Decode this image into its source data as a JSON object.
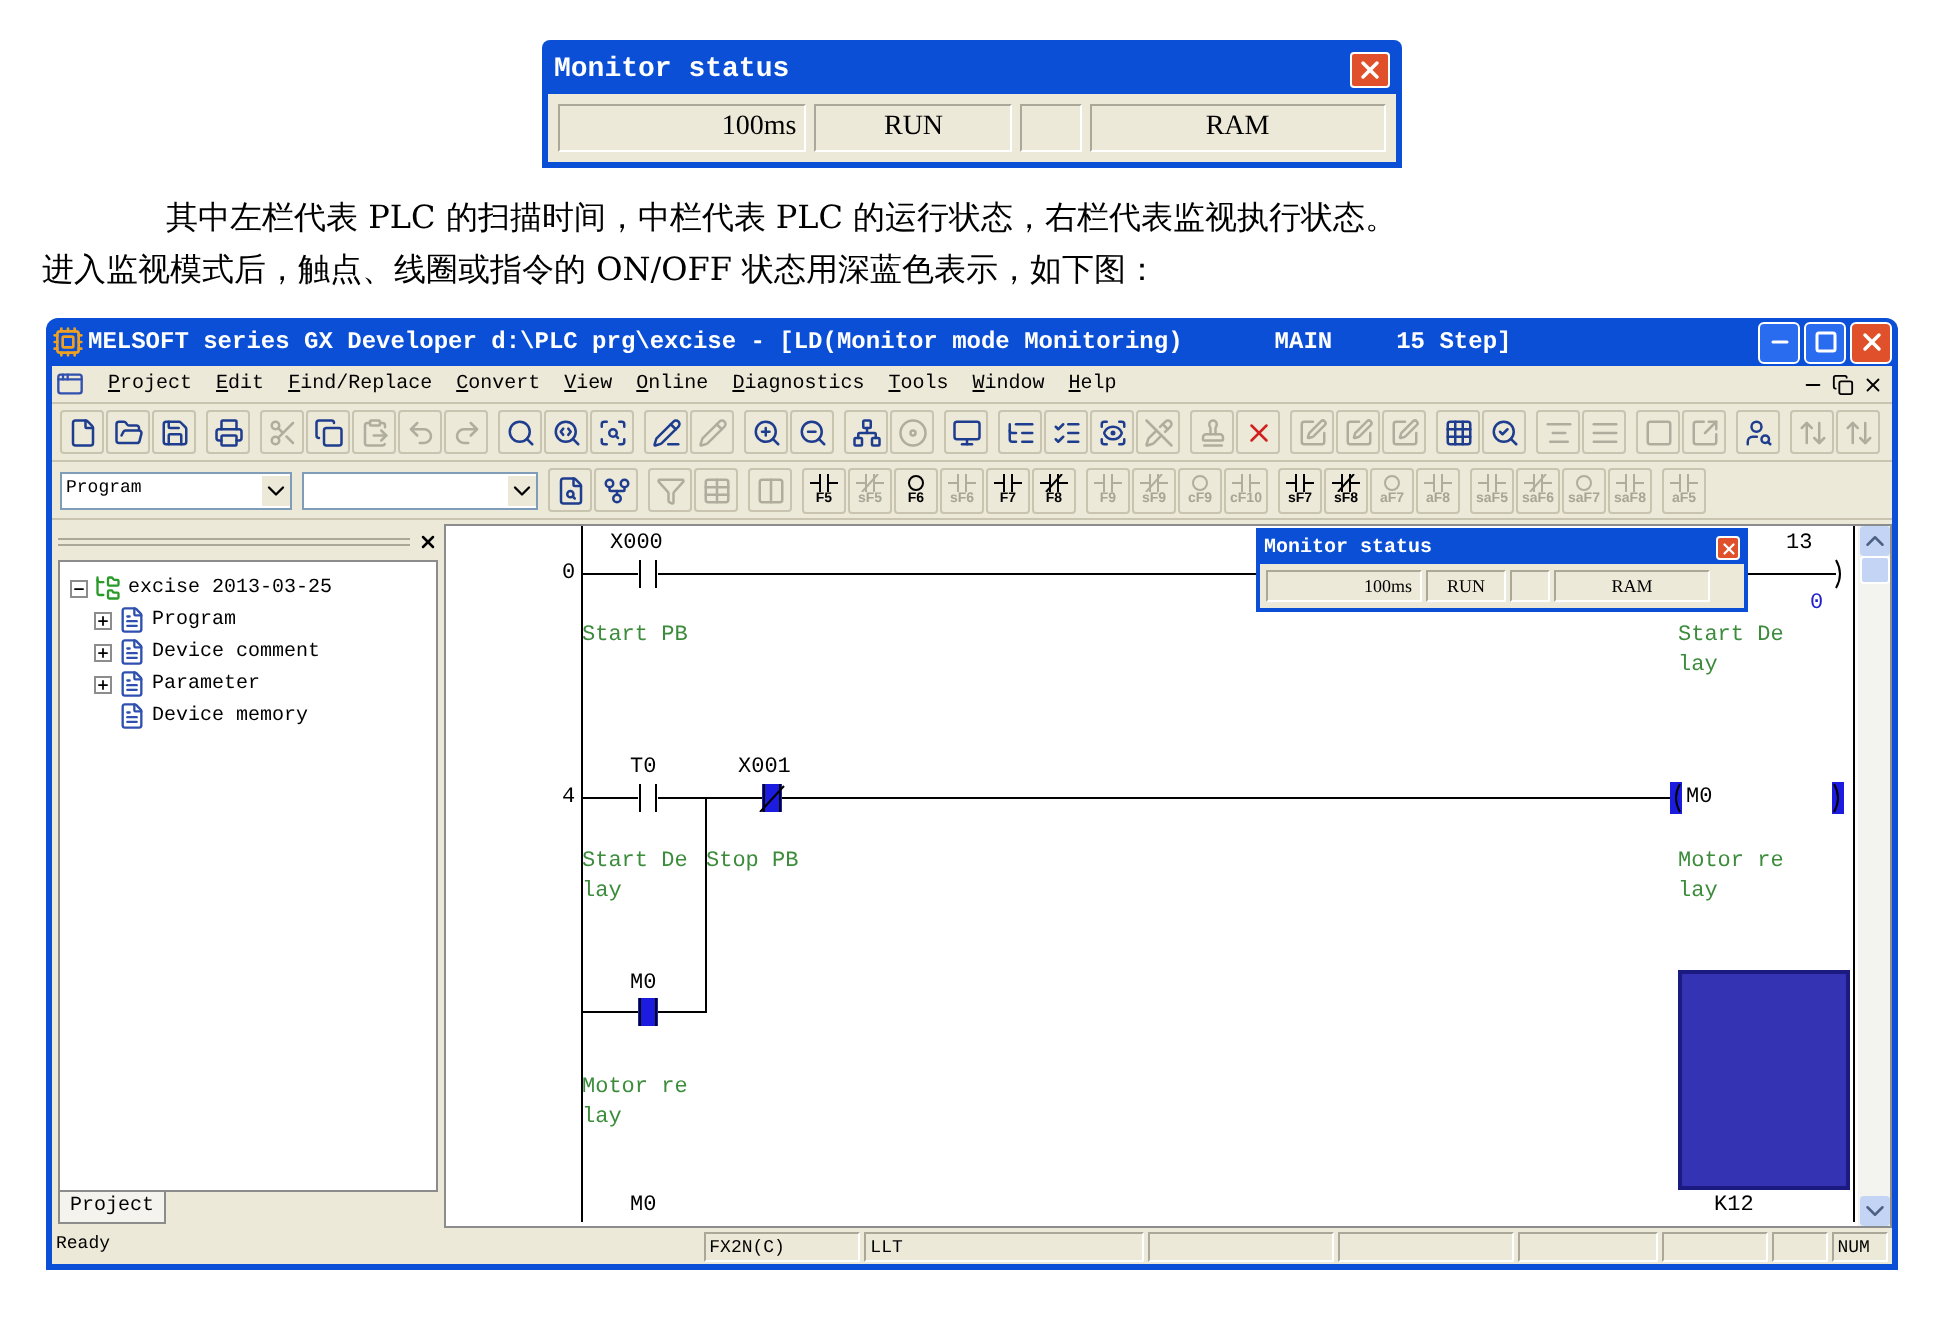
{
  "monitor_dialog": {
    "title": "Monitor status",
    "cells": [
      {
        "text": "100ms"
      },
      {
        "text": "RUN"
      },
      {},
      {
        "text": "RAM"
      }
    ]
  },
  "paragraph_lines": [
    "其中左栏代表 PLC 的扫描时间，中栏代表 PLC 的运行状态，右栏代表监视执行状态。",
    "进入监视模式后，触点、线圈或指令的 ON/OFF 状态用深蓝色表示，如下图："
  ],
  "window": {
    "title_parts": [
      "MELSOFT series GX Developer d:\\PLC prg\\excise - [LD(Monitor mode Monitoring)",
      "MAIN",
      "15 Step]"
    ],
    "menu": [
      "Project",
      "Edit",
      "Find/Replace",
      "Convert",
      "View",
      "Online",
      "Diagnostics",
      "Tools",
      "Window",
      "Help"
    ],
    "toolbar_1": [
      [
        {
          "disabled": false
        },
        {
          "disabled": false
        },
        {
          "disabled": false
        }
      ],
      [
        {
          "disabled": false
        }
      ],
      [
        {
          "disabled": true
        },
        {
          "disabled": false
        },
        {
          "disabled": true
        },
        {
          "disabled": true
        },
        {
          "disabled": true
        }
      ],
      [
        {
          "disabled": false
        },
        {
          "disabled": false
        },
        {
          "disabled": false
        }
      ],
      [
        {
          "disabled": false
        },
        {
          "disabled": true
        }
      ],
      [
        {
          "disabled": false
        },
        {
          "disabled": false
        }
      ],
      [
        {
          "disabled": false
        },
        {
          "disabled": true
        }
      ],
      [
        {
          "disabled": false
        }
      ],
      [
        {
          "disabled": false
        },
        {
          "disabled": false
        },
        {
          "disabled": false
        },
        {
          "disabled": true
        }
      ],
      [
        {
          "disabled": true
        },
        {
          "disabled": false
        }
      ],
      [
        {
          "disabled": true
        },
        {
          "disabled": true
        },
        {
          "disabled": true
        }
      ],
      [
        {
          "disabled": false
        },
        {
          "disabled": false
        }
      ],
      [
        {
          "disabled": true
        },
        {
          "disabled": true
        }
      ],
      [
        {
          "disabled": true
        },
        {
          "disabled": true
        }
      ],
      [
        {
          "disabled": false
        }
      ],
      [
        {
          "disabled": true
        },
        {
          "disabled": true
        }
      ]
    ],
    "toolbar_2": {
      "program_select": {
        "value": "Program"
      },
      "icons": [
        [
          {
            "disabled": false
          },
          {
            "disabled": false
          }
        ],
        [
          {
            "disabled": true
          },
          {
            "disabled": true
          }
        ],
        [
          {
            "disabled": true
          }
        ]
      ],
      "keys": [
        [
          {
            "label": "F5",
            "disabled": false
          },
          {
            "label": "sF5",
            "disabled": true
          },
          {
            "label": "F6",
            "disabled": false
          },
          {
            "label": "sF6",
            "disabled": true
          },
          {
            "label": "F7",
            "disabled": false
          },
          {
            "label": "F8",
            "disabled": false
          }
        ],
        [
          {
            "label": "F9",
            "disabled": true
          },
          {
            "label": "sF9",
            "disabled": true
          },
          {
            "label": "cF9",
            "disabled": true
          },
          {
            "label": "cF10",
            "disabled": true
          }
        ],
        [
          {
            "label": "sF7",
            "disabled": false
          },
          {
            "label": "sF8",
            "disabled": false
          },
          {
            "label": "aF7",
            "disabled": true
          },
          {
            "label": "aF8",
            "disabled": true
          }
        ],
        [
          {
            "label": "saF5",
            "disabled": true
          },
          {
            "label": "saF6",
            "disabled": true
          },
          {
            "label": "saF7",
            "disabled": true
          },
          {
            "label": "saF8",
            "disabled": true
          }
        ],
        [
          {
            "label": "aF5",
            "disabled": true
          }
        ]
      ]
    },
    "project_tree": {
      "tab": "Project",
      "root": {
        "label": "excise 2013-03-25",
        "expanded": true,
        "children": [
          {
            "label": "Program",
            "expanded": false
          },
          {
            "label": "Device comment",
            "expanded": false
          },
          {
            "label": "Parameter",
            "expanded": false
          },
          {
            "label": "Device memory"
          }
        ]
      }
    },
    "ladder": {
      "monitor_dialog": {
        "title": "Monitor status",
        "cells": [
          {
            "text": "100ms"
          },
          {
            "text": "RUN"
          },
          {},
          {
            "text": "RAM"
          }
        ]
      },
      "step_numbers": [
        "0",
        "4"
      ],
      "contacts": [
        {
          "device": "X000",
          "kind": "no",
          "on": false
        },
        {
          "device": "T0",
          "kind": "no",
          "on": false
        },
        {
          "device": "X001",
          "kind": "nc",
          "on": true
        },
        {
          "device": "M0",
          "kind": "no",
          "on": true
        }
      ],
      "comments": [
        {
          "lines": [
            "Start PB"
          ]
        },
        {
          "lines": [
            "Start De",
            "lay"
          ]
        },
        {
          "lines": [
            "Start De",
            "lay"
          ]
        },
        {
          "lines": [
            "Stop PB"
          ]
        },
        {
          "lines": [
            "Motor re",
            "lay"
          ]
        },
        {
          "lines": [
            "Motor re",
            "lay"
          ]
        }
      ],
      "rung_0_output": {
        "partial_text": "13",
        "current_value": "0",
        "on": false
      },
      "coil": {
        "device": "M0",
        "on": true
      },
      "timer_block": {
        "on": true,
        "setting": "K12"
      },
      "next_device": "M0"
    },
    "status_bar": {
      "message": "Ready",
      "cells": [
        {
          "text": "FX2N(C)"
        },
        {
          "text": "LLT"
        },
        {},
        {},
        {},
        {},
        {},
        {
          "text": "NUM"
        }
      ]
    }
  }
}
